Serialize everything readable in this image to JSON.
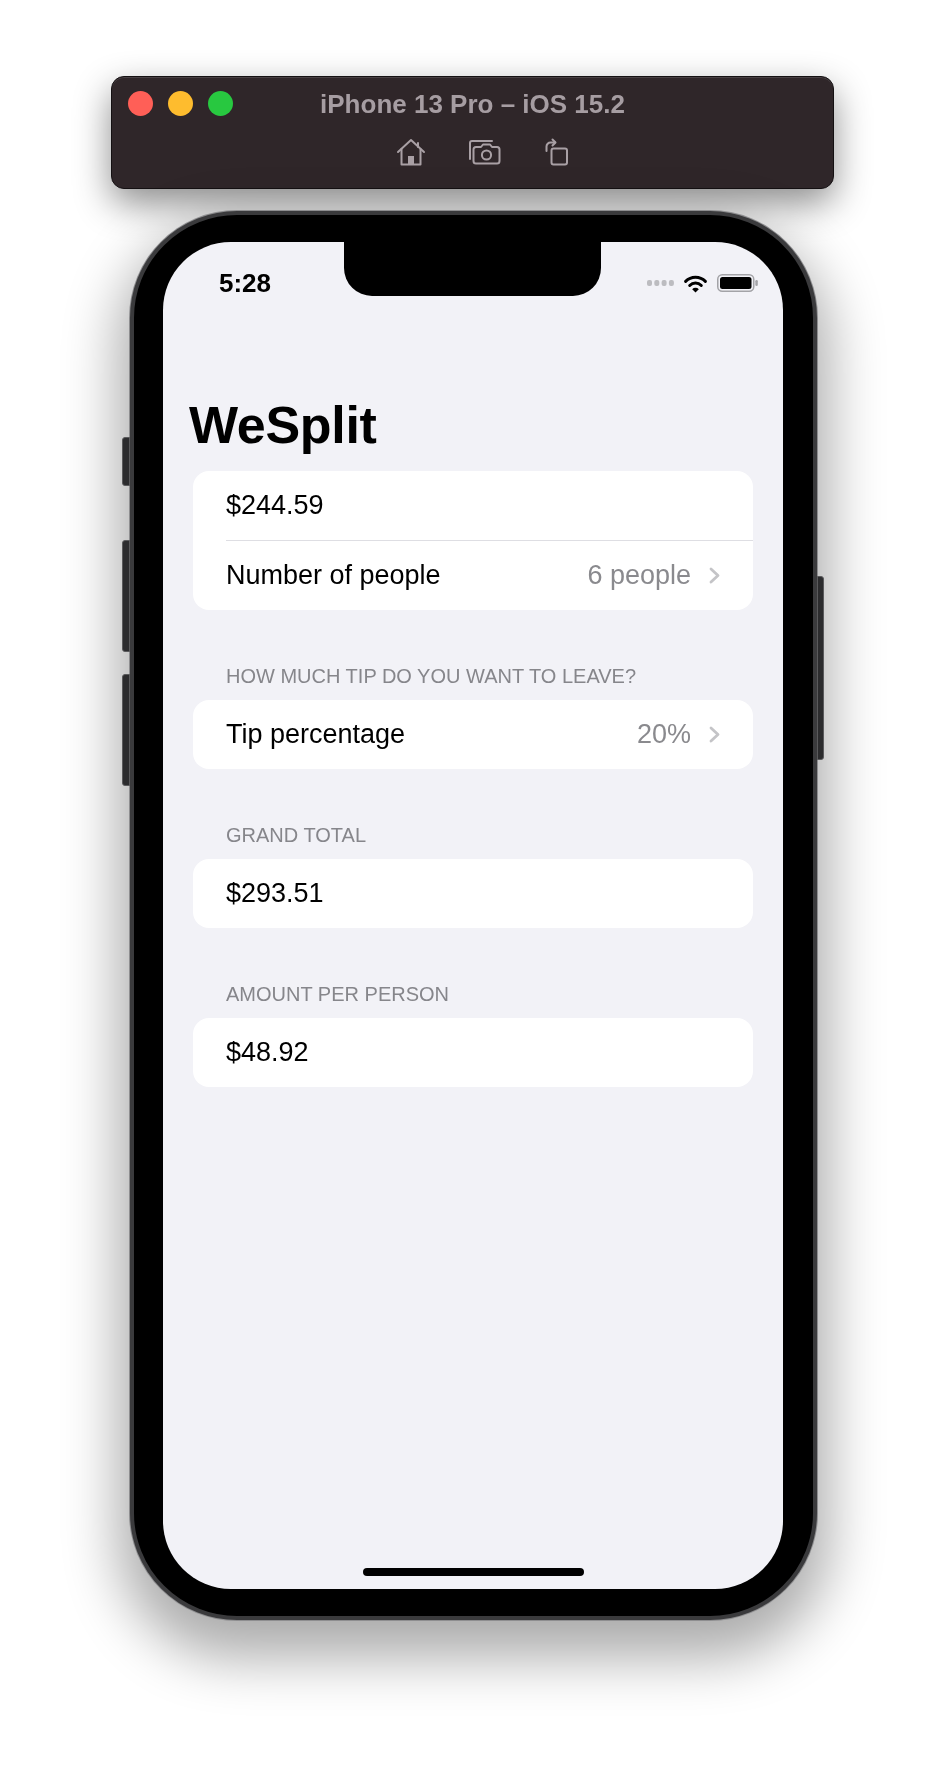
{
  "window": {
    "title": "iPhone 13 Pro – iOS 15.2"
  },
  "status_bar": {
    "time": "5:28"
  },
  "navigation": {
    "title": "WeSplit"
  },
  "sections": [
    {
      "rows": [
        {
          "kind": "field",
          "value": "$244.59"
        },
        {
          "kind": "picker",
          "label": "Number of people",
          "value": "6 people"
        }
      ]
    },
    {
      "header": "HOW MUCH TIP DO YOU WANT TO LEAVE?",
      "rows": [
        {
          "kind": "picker",
          "label": "Tip percentage",
          "value": "20%"
        }
      ]
    },
    {
      "header": "GRAND TOTAL",
      "rows": [
        {
          "kind": "text",
          "value": "$293.51"
        }
      ]
    },
    {
      "header": "AMOUNT PER PERSON",
      "rows": [
        {
          "kind": "text",
          "value": "$48.92"
        }
      ]
    }
  ]
}
